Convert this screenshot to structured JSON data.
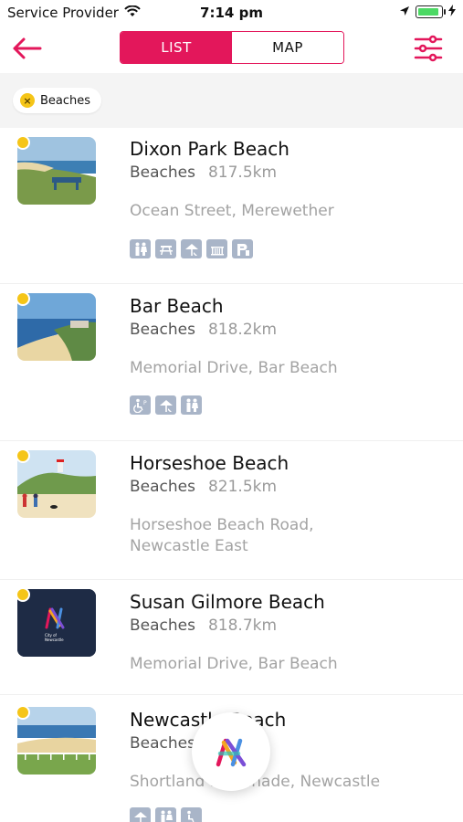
{
  "status_bar": {
    "carrier": "Service Provider",
    "time": "7:14 pm"
  },
  "nav": {
    "tabs": [
      {
        "label": "LIST",
        "active": true
      },
      {
        "label": "MAP",
        "active": false
      }
    ]
  },
  "filters": {
    "chips": [
      {
        "label": "Beaches"
      }
    ]
  },
  "items": [
    {
      "name": "Dixon Park Beach",
      "category": "Beaches",
      "distance": "817.5km",
      "address": "Ocean Street, Merewether",
      "amenities": [
        "toilets-icon",
        "picnic-icon",
        "shelter-icon",
        "bbq-icon",
        "parking-icon"
      ]
    },
    {
      "name": "Bar Beach",
      "category": "Beaches",
      "distance": "818.2km",
      "address": "Memorial Drive, Bar Beach",
      "amenities": [
        "accessible-parking-icon",
        "shelter-icon",
        "toilets-icon"
      ]
    },
    {
      "name": "Horseshoe Beach",
      "category": "Beaches",
      "distance": "821.5km",
      "address": "Horseshoe Beach Road, Newcastle East",
      "amenities": []
    },
    {
      "name": "Susan Gilmore Beach",
      "category": "Beaches",
      "distance": "818.7km",
      "address": "Memorial Drive, Bar Beach",
      "amenities": []
    },
    {
      "name": "Newcastle Beach",
      "category": "Beaches",
      "distance": "",
      "address": "Shortland Esplanade, Newcastle",
      "amenities": [
        "shelter-icon",
        "toilets-icon",
        "accessible-parking-icon"
      ]
    }
  ],
  "logo_text": "City of Newcastle",
  "colors": {
    "accent": "#e3175b",
    "marker": "#f5c518",
    "amenity": "#a9b5c8"
  }
}
